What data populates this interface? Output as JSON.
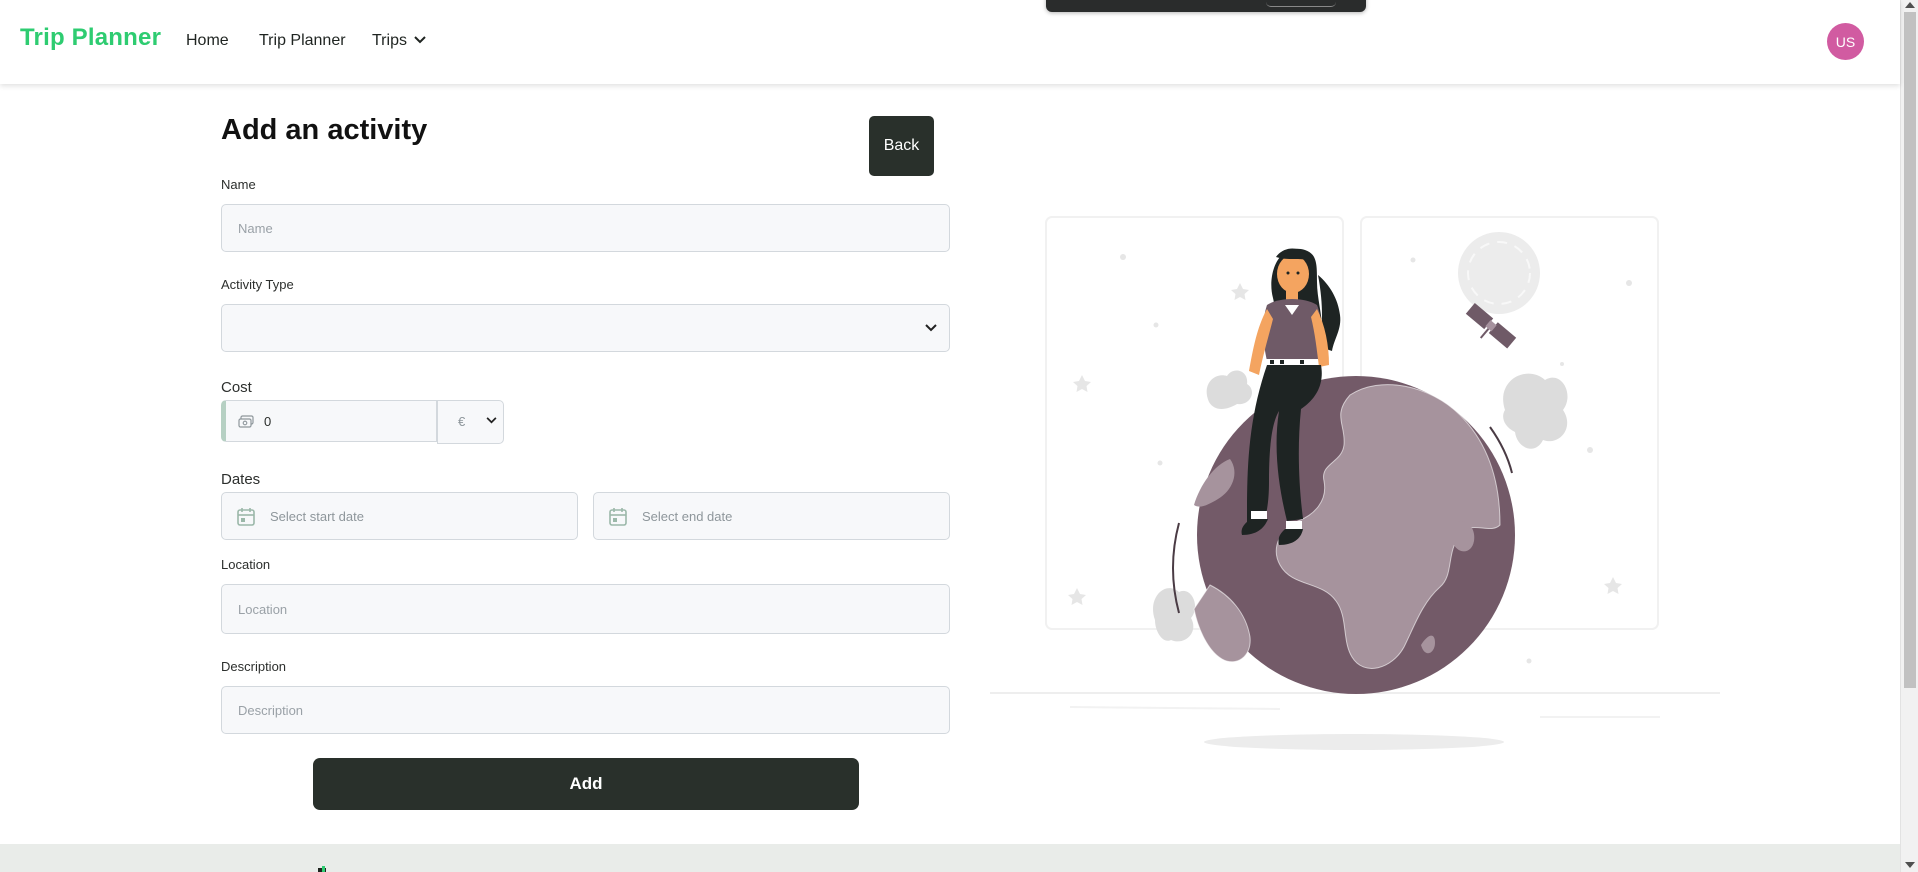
{
  "navbar": {
    "brand": "Trip Planner",
    "links": {
      "home": "Home",
      "planner": "Trip Planner",
      "trips": "Trips"
    },
    "avatar_initials": "US"
  },
  "form": {
    "title": "Add an activity",
    "back_label": "Back",
    "name": {
      "label": "Name",
      "placeholder": "Name",
      "value": ""
    },
    "activity_type": {
      "label": "Activity Type",
      "selected": ""
    },
    "cost": {
      "label": "Cost",
      "value": "0",
      "currency": "€"
    },
    "dates": {
      "label": "Dates",
      "start_placeholder": "Select start date",
      "end_placeholder": "Select end date"
    },
    "location": {
      "label": "Location",
      "placeholder": "Location"
    },
    "description": {
      "label": "Description",
      "placeholder": "Description"
    },
    "submit_label": "Add"
  },
  "colors": {
    "brand": "#2ecc71",
    "button_dark": "#29302b",
    "avatar": "#d15ba1",
    "globe": "#735a68",
    "globe_land": "#9c8b94"
  },
  "illustration": {
    "icon": "woman-sitting-on-globe-illustration"
  }
}
